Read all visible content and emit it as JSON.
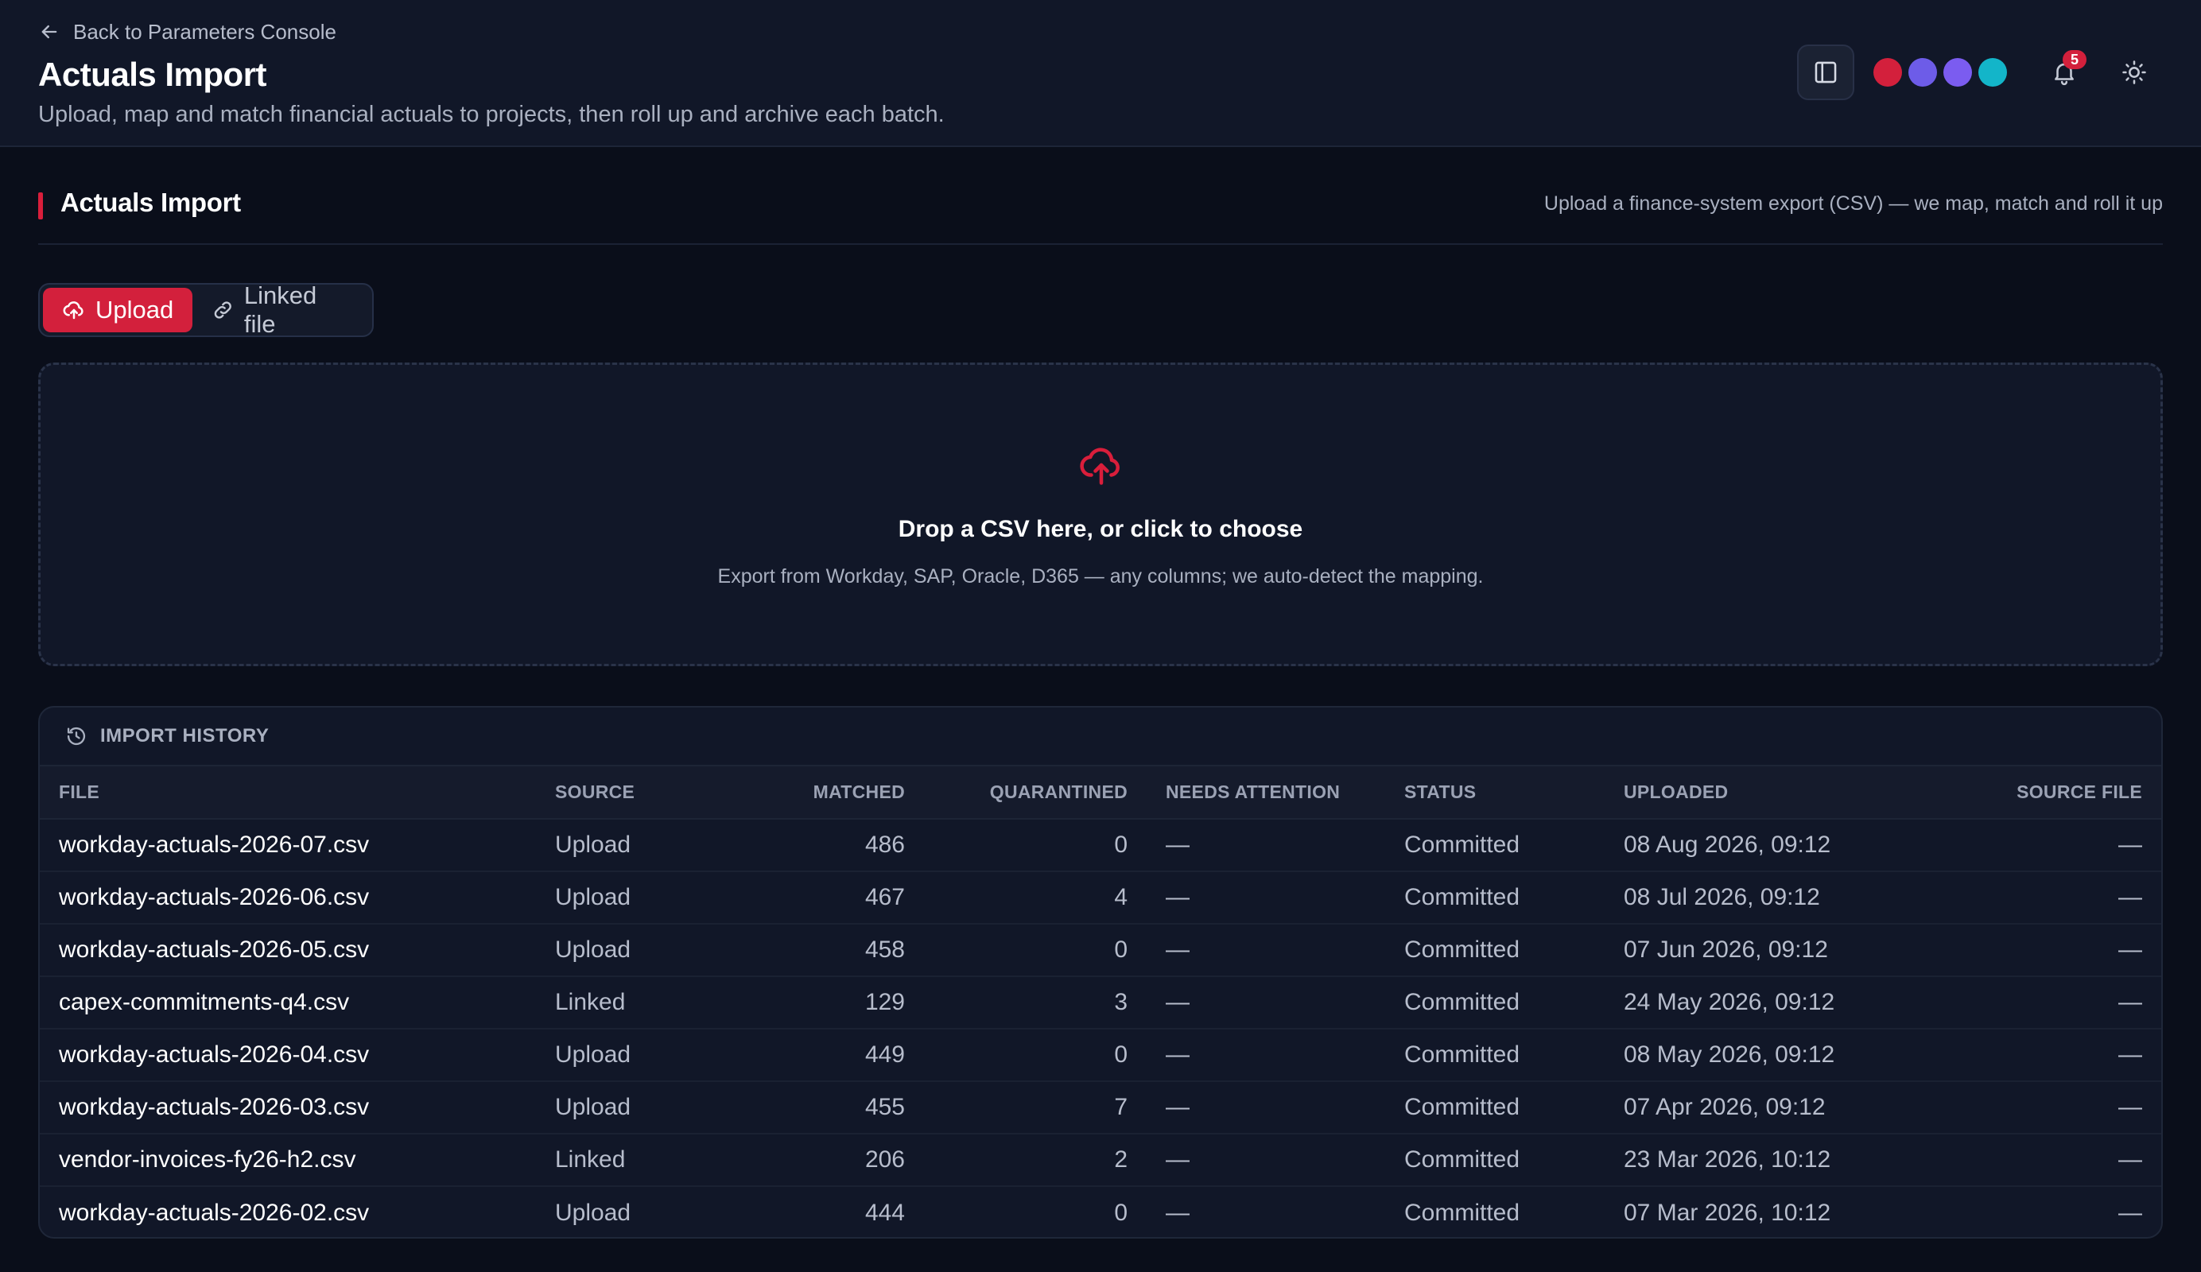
{
  "header": {
    "back_label": "Back to Parameters Console",
    "title": "Actuals Import",
    "subtitle": "Upload, map and match financial actuals to projects, then roll up and archive each batch.",
    "notification_count": "5",
    "theme_swatches": [
      "#d3203c",
      "#6d5ce8",
      "#7b5cf0",
      "#13b5c9"
    ]
  },
  "section": {
    "title": "Actuals Import",
    "hint": "Upload a finance-system export (CSV) — we map, match and roll it up"
  },
  "mode_toggle": {
    "upload_label": "Upload",
    "linked_label": "Linked file",
    "selected": "Upload"
  },
  "dropzone": {
    "title": "Drop a CSV here, or click to choose",
    "hint": "Export from Workday, SAP, Oracle, D365 — any columns; we auto-detect the mapping."
  },
  "history": {
    "title": "IMPORT HISTORY",
    "columns": [
      "FILE",
      "SOURCE",
      "MATCHED",
      "QUARANTINED",
      "NEEDS ATTENTION",
      "STATUS",
      "UPLOADED",
      "SOURCE FILE"
    ],
    "rows": [
      {
        "file": "workday-actuals-2026-07.csv",
        "source": "Upload",
        "matched": "486",
        "quarantined": "0",
        "needs_attention": "—",
        "status": "Committed",
        "uploaded": "08 Aug 2026, 09:12",
        "source_file": "—"
      },
      {
        "file": "workday-actuals-2026-06.csv",
        "source": "Upload",
        "matched": "467",
        "quarantined": "4",
        "needs_attention": "—",
        "status": "Committed",
        "uploaded": "08 Jul 2026, 09:12",
        "source_file": "—"
      },
      {
        "file": "workday-actuals-2026-05.csv",
        "source": "Upload",
        "matched": "458",
        "quarantined": "0",
        "needs_attention": "—",
        "status": "Committed",
        "uploaded": "07 Jun 2026, 09:12",
        "source_file": "—"
      },
      {
        "file": "capex-commitments-q4.csv",
        "source": "Linked",
        "matched": "129",
        "quarantined": "3",
        "needs_attention": "—",
        "status": "Committed",
        "uploaded": "24 May 2026, 09:12",
        "source_file": "—"
      },
      {
        "file": "workday-actuals-2026-04.csv",
        "source": "Upload",
        "matched": "449",
        "quarantined": "0",
        "needs_attention": "—",
        "status": "Committed",
        "uploaded": "08 May 2026, 09:12",
        "source_file": "—"
      },
      {
        "file": "workday-actuals-2026-03.csv",
        "source": "Upload",
        "matched": "455",
        "quarantined": "7",
        "needs_attention": "—",
        "status": "Committed",
        "uploaded": "07 Apr 2026, 09:12",
        "source_file": "—"
      },
      {
        "file": "vendor-invoices-fy26-h2.csv",
        "source": "Linked",
        "matched": "206",
        "quarantined": "2",
        "needs_attention": "—",
        "status": "Committed",
        "uploaded": "23 Mar 2026, 10:12",
        "source_file": "—"
      },
      {
        "file": "workday-actuals-2026-02.csv",
        "source": "Upload",
        "matched": "444",
        "quarantined": "0",
        "needs_attention": "—",
        "status": "Committed",
        "uploaded": "07 Mar 2026, 10:12",
        "source_file": "—"
      }
    ]
  }
}
